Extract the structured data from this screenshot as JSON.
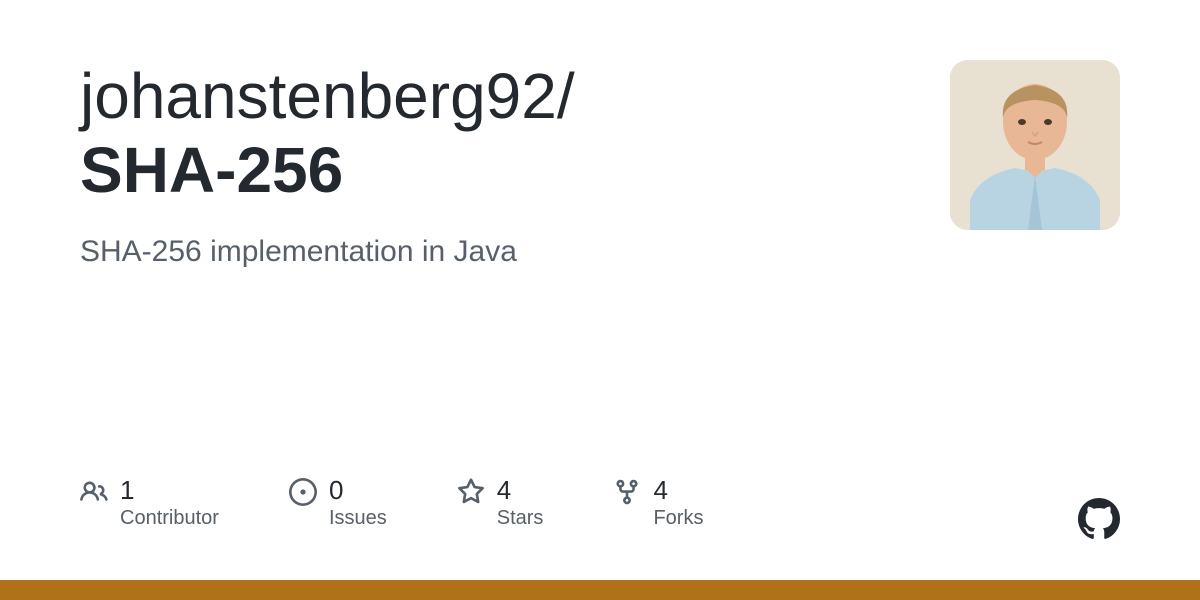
{
  "repo": {
    "owner": "johanstenberg92",
    "separator": "/",
    "name": "SHA-256",
    "description": "SHA-256 implementation in Java"
  },
  "stats": {
    "contributors": {
      "value": "1",
      "label": "Contributor"
    },
    "issues": {
      "value": "0",
      "label": "Issues"
    },
    "stars": {
      "value": "4",
      "label": "Stars"
    },
    "forks": {
      "value": "4",
      "label": "Forks"
    }
  },
  "language_color": "#b07219"
}
